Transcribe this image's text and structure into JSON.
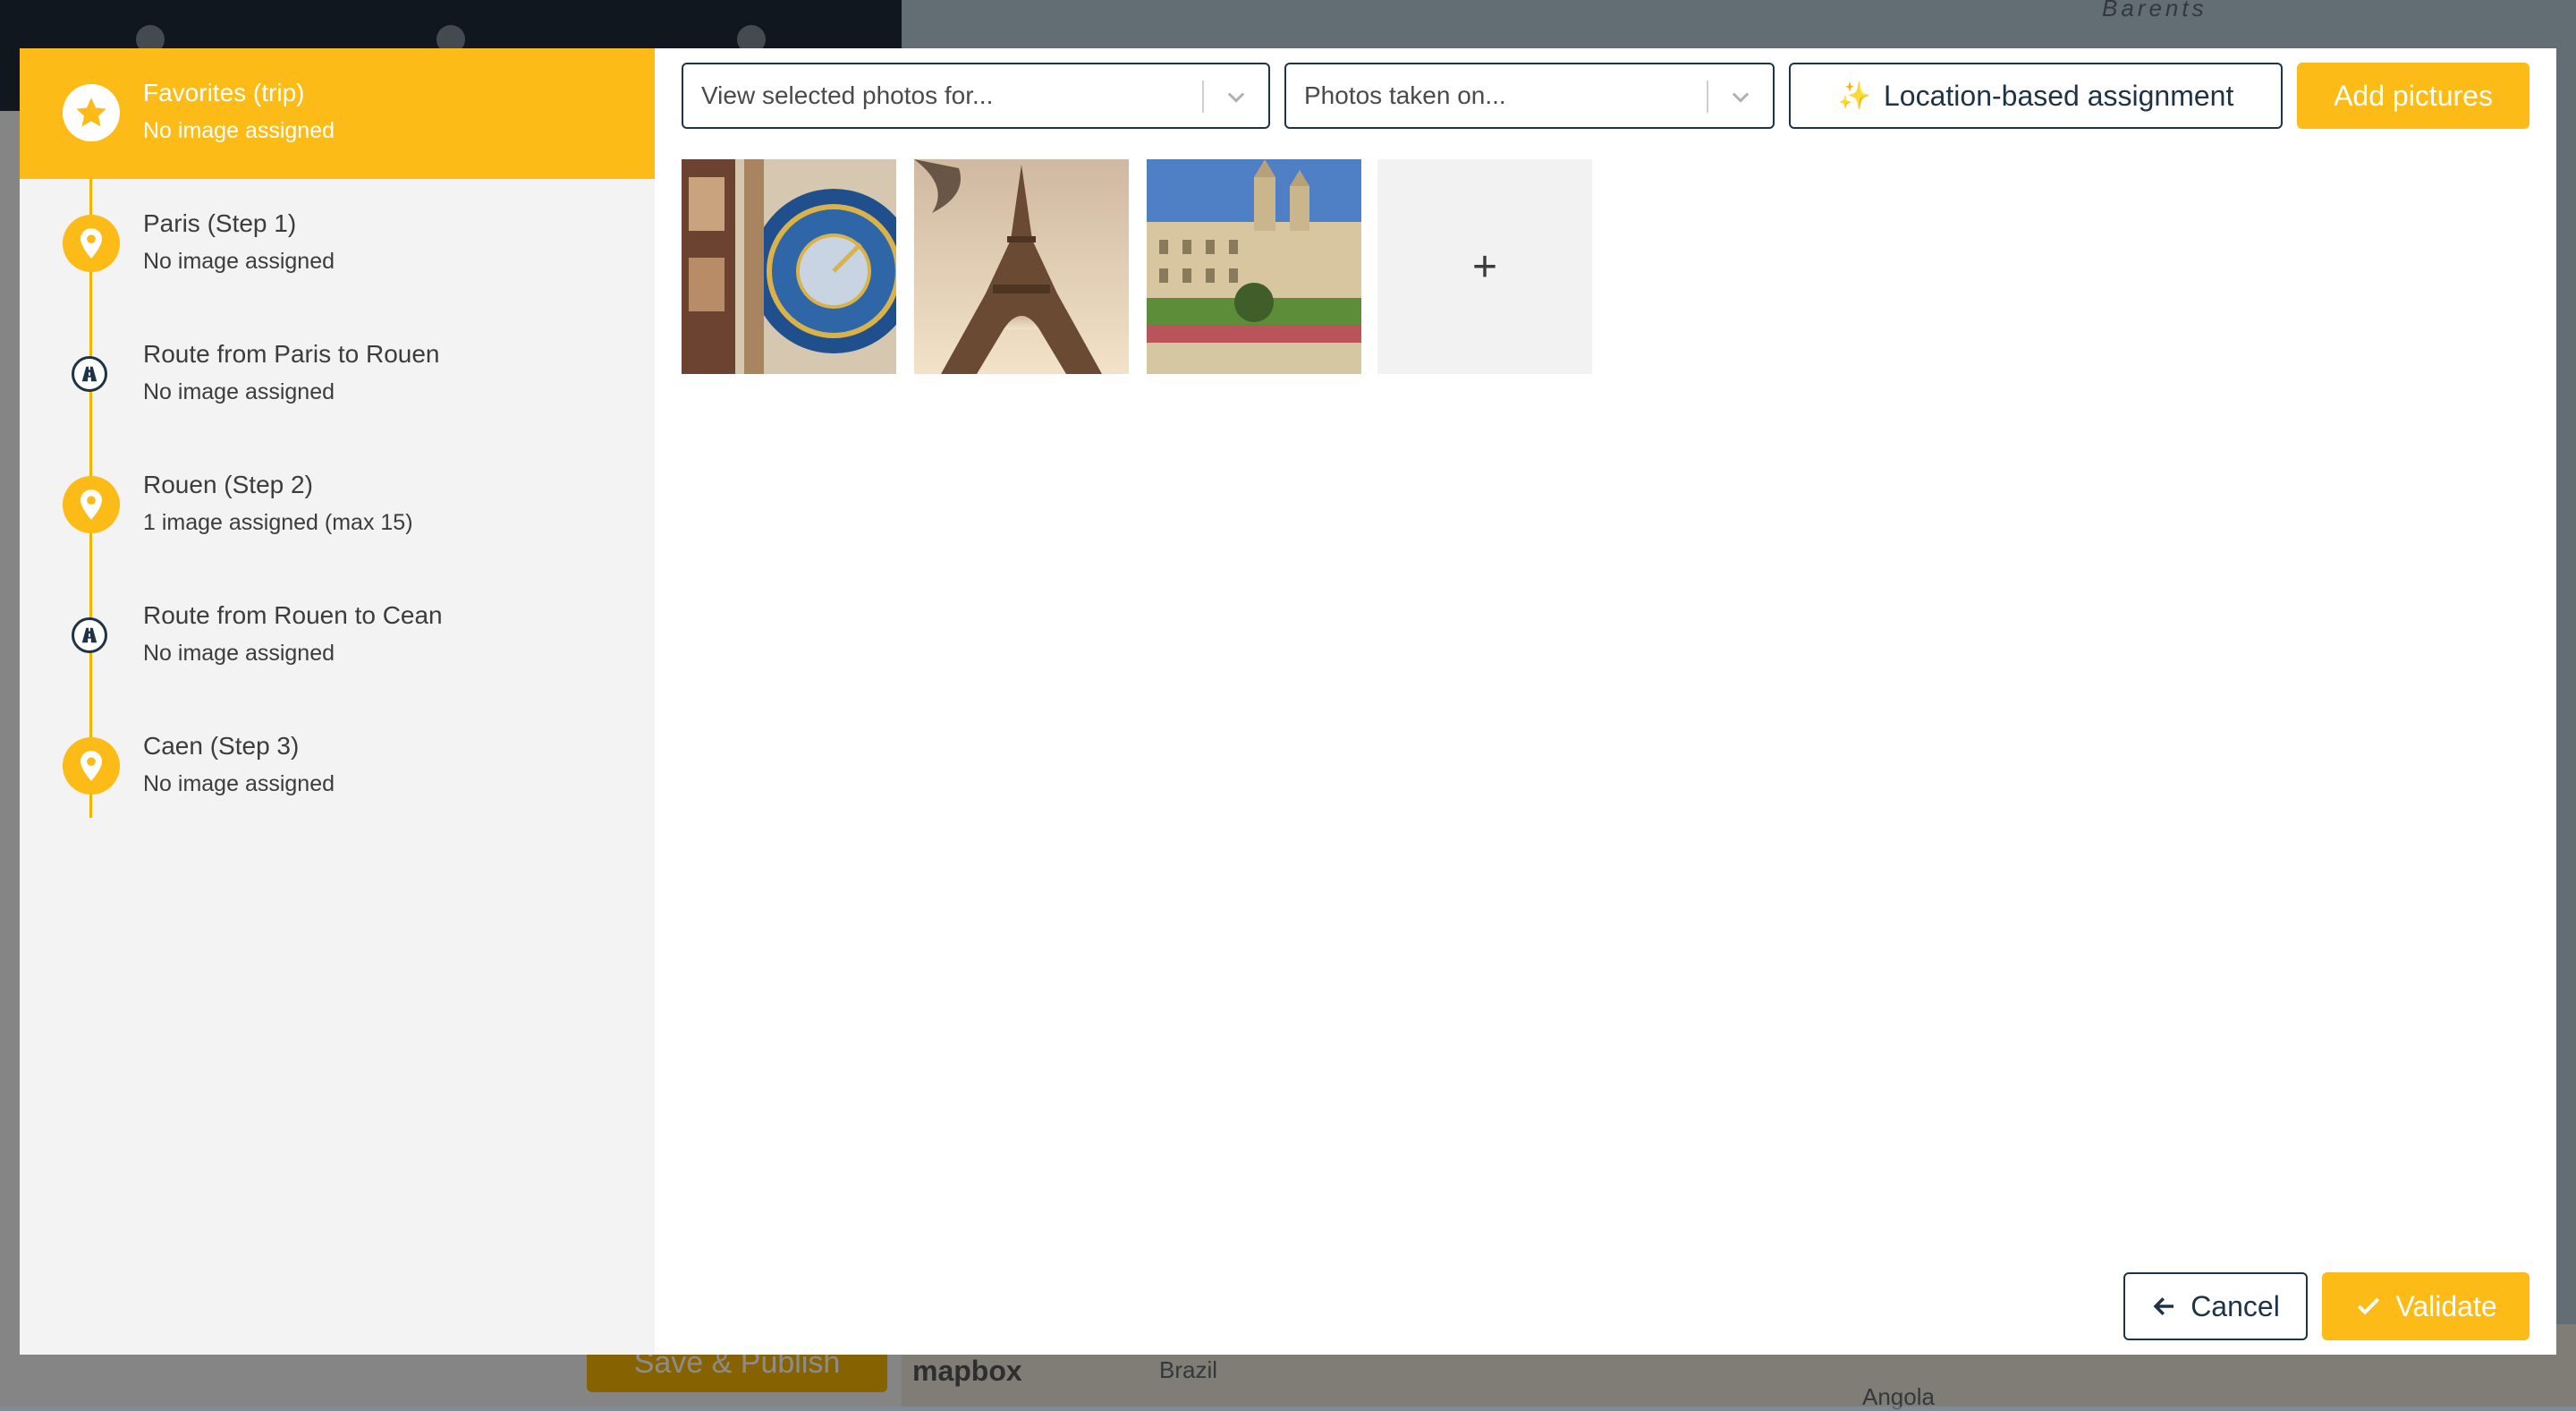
{
  "background": {
    "map_labels": [
      "Barents",
      "Brazil",
      "Angola"
    ],
    "map_attribution": "mapbox",
    "save_publish_label": "Save & Publish"
  },
  "sidebar": {
    "steps": [
      {
        "title": "Favorites (trip)",
        "subtitle": "No image assigned",
        "icon": "star-icon",
        "active": true
      },
      {
        "title": "Paris (Step 1)",
        "subtitle": "No image assigned",
        "icon": "map-pin-icon",
        "active": false
      },
      {
        "title": "Route from Paris to Rouen",
        "subtitle": "No image assigned",
        "icon": "road-icon",
        "active": false
      },
      {
        "title": "Rouen (Step 2)",
        "subtitle": "1 image assigned (max 15)",
        "icon": "map-pin-icon",
        "active": false
      },
      {
        "title": "Route from Rouen to Cean",
        "subtitle": "No image assigned",
        "icon": "road-icon",
        "active": false
      },
      {
        "title": "Caen (Step 3)",
        "subtitle": "No image assigned",
        "icon": "map-pin-icon",
        "active": false
      }
    ]
  },
  "toolbar": {
    "view_select_placeholder": "View selected photos for...",
    "date_select_placeholder": "Photos taken on...",
    "location_button_label": "Location-based assignment",
    "location_button_icon": "sparkles-icon",
    "add_pictures_label": "Add pictures"
  },
  "photos": [
    {
      "name": "Rouen astronomical clock"
    },
    {
      "name": "Eiffel Tower"
    },
    {
      "name": "Abbaye aux Hommes, Caen"
    }
  ],
  "add_photo_symbol": "+",
  "footer": {
    "cancel_label": "Cancel",
    "validate_label": "Validate"
  },
  "colors": {
    "accent": "#fdbb17",
    "navy": "#1f3347",
    "sidebar_bg": "#f3f3f3"
  }
}
